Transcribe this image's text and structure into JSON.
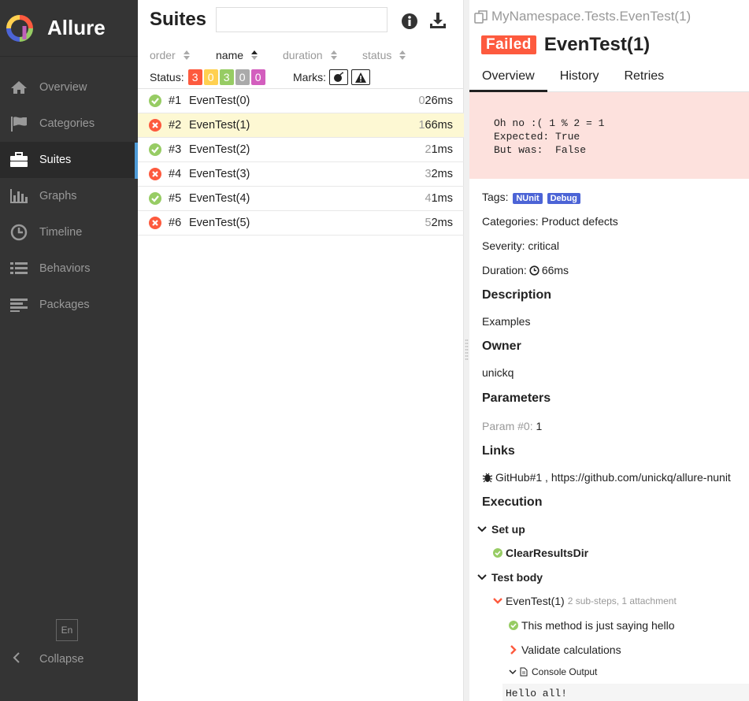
{
  "app": {
    "name": "Allure",
    "logo_colors": [
      "#fd5a3e",
      "#ffd050",
      "#97cc64",
      "#4c64d6",
      "#c061b9"
    ]
  },
  "sidebar": {
    "items": [
      {
        "label": "Overview",
        "icon": "home-icon"
      },
      {
        "label": "Categories",
        "icon": "flag-icon"
      },
      {
        "label": "Suites",
        "icon": "briefcase-icon",
        "active": true
      },
      {
        "label": "Graphs",
        "icon": "bar-chart-icon"
      },
      {
        "label": "Timeline",
        "icon": "clock-icon"
      },
      {
        "label": "Behaviors",
        "icon": "list-icon"
      },
      {
        "label": "Packages",
        "icon": "align-left-icon"
      }
    ],
    "language": "En",
    "collapse_label": "Collapse"
  },
  "suites": {
    "title": "Suites",
    "search_placeholder": "",
    "sorters": {
      "order": "order",
      "name": "name",
      "duration": "duration",
      "status": "status"
    },
    "status_label": "Status:",
    "status_counts": [
      {
        "value": "3",
        "color": "#fd5a3e"
      },
      {
        "value": "0",
        "color": "#ffd050"
      },
      {
        "value": "3",
        "color": "#97cc64"
      },
      {
        "value": "0",
        "color": "#aaaaaa"
      },
      {
        "value": "0",
        "color": "#d35ebe"
      }
    ],
    "marks_label": "Marks:",
    "rows": [
      {
        "num": "#1",
        "name": "EvenTest(0)",
        "dur_prefix": "0",
        "dur": "26ms",
        "status": "passed"
      },
      {
        "num": "#2",
        "name": "EvenTest(1)",
        "dur_prefix": "1",
        "dur": "66ms",
        "status": "failed"
      },
      {
        "num": "#3",
        "name": "EvenTest(2)",
        "dur_prefix": "2",
        "dur": "1ms",
        "status": "passed"
      },
      {
        "num": "#4",
        "name": "EvenTest(3)",
        "dur_prefix": "3",
        "dur": "2ms",
        "status": "failed"
      },
      {
        "num": "#5",
        "name": "EvenTest(4)",
        "dur_prefix": "4",
        "dur": "1ms",
        "status": "passed"
      },
      {
        "num": "#6",
        "name": "EvenTest(5)",
        "dur_prefix": "5",
        "dur": "2ms",
        "status": "failed"
      }
    ]
  },
  "detail": {
    "breadcrumb": "MyNamespace.Tests.EvenTest(1)",
    "status": "Failed",
    "title": "EvenTest(1)",
    "tabs": [
      "Overview",
      "History",
      "Retries"
    ],
    "error": "Oh no :( 1 % 2 = 1\nExpected: True\nBut was:  False",
    "tags_label": "Tags:",
    "tags": [
      "NUnit",
      "Debug"
    ],
    "categories": "Categories: Product defects",
    "severity": "Severity: critical",
    "duration_label": "Duration:",
    "duration": "66ms",
    "description_title": "Description",
    "description": "Examples",
    "owner_title": "Owner",
    "owner": "unickq",
    "parameters_title": "Parameters",
    "param_name": "Param #0:",
    "param_value": "1",
    "links_title": "Links",
    "link": "GitHub#1 , https://github.com/unickq/allure-nunit",
    "execution_title": "Execution",
    "setup_label": "Set up",
    "setup_step": "ClearResultsDir",
    "body_label": "Test body",
    "body_step": "EvenTest(1)",
    "body_step_meta": "2 sub-steps, 1 attachment",
    "sub_step_1": "This method is just saying hello",
    "sub_step_2": "Validate calculations",
    "attachment": "Console Output",
    "console_text": "Hello all!"
  }
}
